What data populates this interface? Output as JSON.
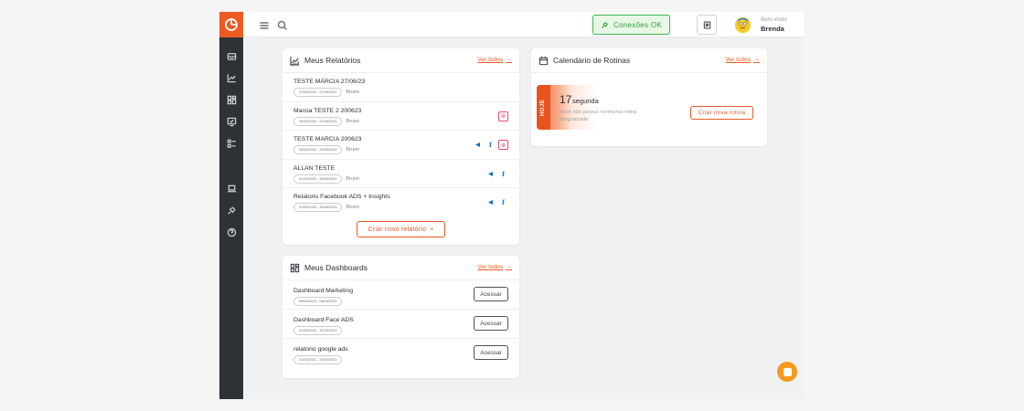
{
  "topbar": {
    "connections_label": "Conexões OK",
    "welcome": "Bem-vindo",
    "username": "Brenda"
  },
  "reports": {
    "title": "Meus Relatórios",
    "see_all": "Ver todos",
    "create_label": "Criar novo relatório",
    "items": [
      {
        "name": "TESTE MÁRCIA 27/06/23",
        "dates": "27/06/2023 - 27/06/2023",
        "author": "Bruno",
        "networks": []
      },
      {
        "name": "Marcia TESTE 2 200623",
        "dates": "20/06/2023 - 20/06/2023",
        "author": "Bruno",
        "networks": [
          "instagram"
        ]
      },
      {
        "name": "TESTE MARCIA 200623",
        "dates": "20/06/2023 - 20/06/2023",
        "author": "Bruno",
        "networks": [
          "meta-ads",
          "facebook",
          "instagram"
        ]
      },
      {
        "name": "ALLAN TESTE",
        "dates": "01/06/2023 - 30/06/2023",
        "author": "Bruno",
        "networks": [
          "meta-ads",
          "facebook"
        ]
      },
      {
        "name": "Relatorio Facebook ADS + Insights",
        "dates": "01/06/2023 - 30/06/2023",
        "author": "Bruno",
        "networks": [
          "meta-ads",
          "facebook"
        ]
      }
    ]
  },
  "dashboards": {
    "title": "Meus Dashboards",
    "see_all": "Ver todos",
    "access_label": "Acessar",
    "items": [
      {
        "name": "Dashboard Marketing",
        "dates": "05/06/2023 - 08/06/2023"
      },
      {
        "name": "Dashboard Face ADS",
        "dates": "01/05/2023 - 31/05/2023"
      },
      {
        "name": "relatorio google ads",
        "dates": "01/03/2021 - 31/03/2021"
      }
    ]
  },
  "calendar": {
    "title": "Calendário de Rotinas",
    "see_all": "Ver todos",
    "today_tag": "HOJE",
    "day_number": "17",
    "day_name": "segunda",
    "no_routine": "Você não possui nenhuma rotina programada",
    "create_label": "Criar nova rotina"
  },
  "colors": {
    "accent": "#e85a24",
    "sidebar": "#2c3236",
    "success": "#3bb54a"
  }
}
